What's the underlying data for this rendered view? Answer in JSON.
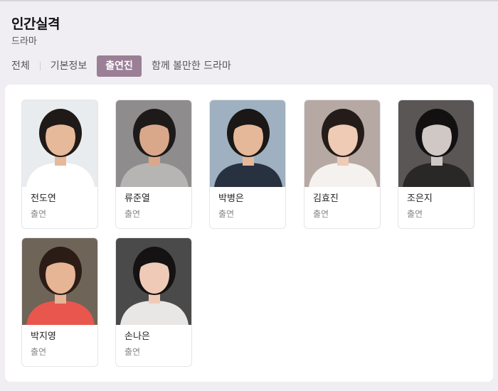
{
  "page": {
    "title": "인간실격",
    "genre": "드라마"
  },
  "tabs": [
    {
      "label": "전체",
      "active": false
    },
    {
      "label": "기본정보",
      "active": false
    },
    {
      "label": "출연진",
      "active": true
    },
    {
      "label": "함께 볼만한 드라마",
      "active": false
    }
  ],
  "cast": [
    {
      "name": "전도연",
      "role": "출연",
      "photo_icon": "actress-portrait",
      "bg": "#e9ecef",
      "hair": "#1f1a18",
      "skin": "#e6b99a",
      "cloth": "#ffffff"
    },
    {
      "name": "류준열",
      "role": "출연",
      "photo_icon": "actor-portrait",
      "bg": "#8f8c8e",
      "hair": "#1d1a19",
      "skin": "#d9a88a",
      "cloth": "#b7b5b4"
    },
    {
      "name": "박병은",
      "role": "출연",
      "photo_icon": "actor-portrait",
      "bg": "#9fb0c0",
      "hair": "#1a1716",
      "skin": "#e4b898",
      "cloth": "#27313f"
    },
    {
      "name": "김효진",
      "role": "출연",
      "photo_icon": "actress-portrait",
      "bg": "#b6a9a4",
      "hair": "#241c19",
      "skin": "#efcab4",
      "cloth": "#f4f1ee"
    },
    {
      "name": "조은지",
      "role": "출연",
      "photo_icon": "actress-portrait",
      "bg": "#5a5656",
      "hair": "#121010",
      "skin": "#cfc8c4",
      "cloth": "#2a2727"
    },
    {
      "name": "박지영",
      "role": "출연",
      "photo_icon": "actress-portrait",
      "bg": "#6f6458",
      "hair": "#2c1c16",
      "skin": "#e5b595",
      "cloth": "#e8564e"
    },
    {
      "name": "손나은",
      "role": "출연",
      "photo_icon": "actress-portrait",
      "bg": "#4b4a4a",
      "hair": "#141212",
      "skin": "#efcbb7",
      "cloth": "#e9e7e6"
    }
  ]
}
